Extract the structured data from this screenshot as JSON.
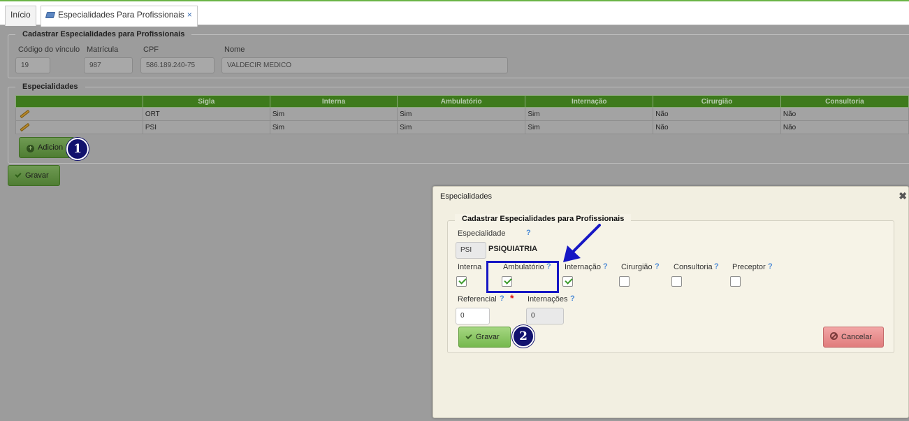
{
  "tabs": [
    {
      "label": "Início",
      "active": false
    },
    {
      "label": "Especialidades Para Profissionais",
      "active": true,
      "close": "×"
    }
  ],
  "vinculo": {
    "legend": "Cadastrar Especialidades para Profissionais",
    "fields": {
      "codigo": {
        "label": "Código do vínculo",
        "value": "19"
      },
      "matricula": {
        "label": "Matrícula",
        "value": "987"
      },
      "cpf": {
        "label": "CPF",
        "value": "586.189.240-75"
      },
      "nome": {
        "label": "Nome",
        "value": "VALDECIR MEDICO"
      }
    }
  },
  "especialidades": {
    "legend": "Especialidades",
    "columns": [
      "Sigla",
      "Interna",
      "Ambulatório",
      "Internação",
      "Cirurgião",
      "Consultoria"
    ],
    "rows": [
      [
        "ORT",
        "Sim",
        "Sim",
        "Sim",
        "Não",
        "Não"
      ],
      [
        "PSI",
        "Sim",
        "Sim",
        "Sim",
        "Não",
        "Não"
      ]
    ],
    "add_label": "Adicion"
  },
  "main_save_label": "Gravar",
  "badges": {
    "one": "1",
    "two": "2"
  },
  "dialog": {
    "title": "Especialidades",
    "close": "✖",
    "legend": "Cadastrar Especialidades para Profissionais",
    "especialidade": {
      "label": "Especialidade",
      "help": "?",
      "code": "PSI",
      "name": "PSIQUIATRIA"
    },
    "checkboxes": [
      {
        "label": "Interna",
        "help": "?",
        "checked": true
      },
      {
        "label": "Ambulatório",
        "help": "?",
        "checked": true
      },
      {
        "label": "Internação",
        "help": "?",
        "checked": true
      },
      {
        "label": "Cirurgião",
        "help": "?",
        "checked": false
      },
      {
        "label": "Consultoria",
        "help": "?",
        "checked": false
      },
      {
        "label": "Preceptor",
        "help": "?",
        "checked": false
      }
    ],
    "referencial": {
      "label": "Referencial",
      "help": "?",
      "required": "*",
      "value": "0"
    },
    "internacoes": {
      "label": "Internações",
      "help": "?",
      "value": "0"
    },
    "save_label": "Gravar",
    "cancel_label": "Cancelar"
  },
  "colors": {
    "accent_green": "#6bb446",
    "header_green": "#3e7a1c",
    "annotation_blue": "#1616c4",
    "badge_navy": "#12126e"
  }
}
